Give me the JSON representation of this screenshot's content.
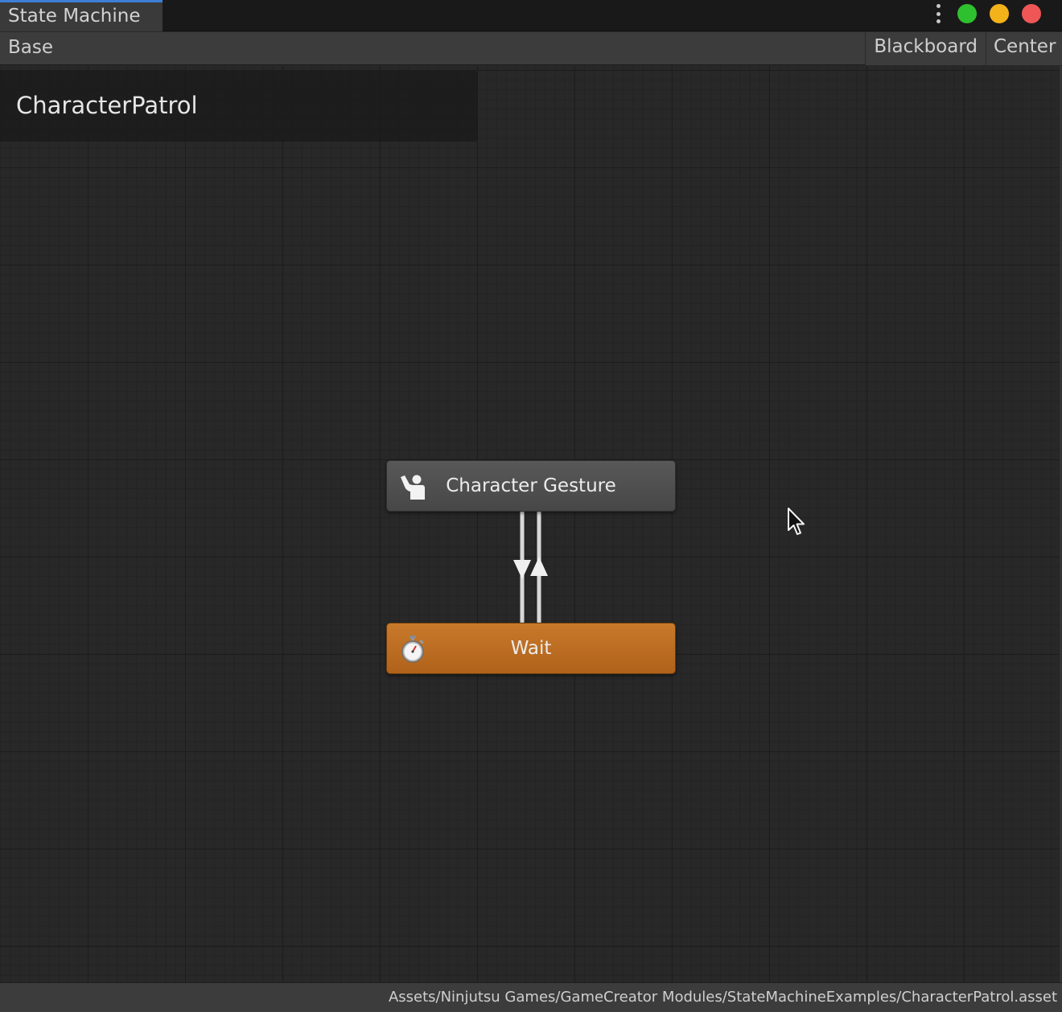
{
  "window": {
    "tab_title": "State Machine",
    "controls": [
      "more-icon",
      "green-dot",
      "yellow-dot",
      "red-dot"
    ],
    "colors": {
      "green": "#2fc02f",
      "yellow": "#f3b21a",
      "red": "#ef5656",
      "tab_accent": "#3d7fd6"
    }
  },
  "toolbar": {
    "breadcrumb": "Base",
    "blackboard_label": "Blackboard",
    "center_label": "Center"
  },
  "graph": {
    "title": "CharacterPatrol",
    "nodes": [
      {
        "label": "Character Gesture",
        "icon": "character-gesture-icon",
        "color": "#4f4f4f"
      },
      {
        "label": "Wait",
        "icon": "stopwatch-icon",
        "color": "#bd6c22"
      }
    ],
    "transitions": [
      "gesture-to-wait",
      "wait-to-gesture"
    ]
  },
  "status": {
    "asset_path": "Assets/Ninjutsu Games/GameCreator Modules/StateMachineExamples/CharacterPatrol.asset"
  }
}
